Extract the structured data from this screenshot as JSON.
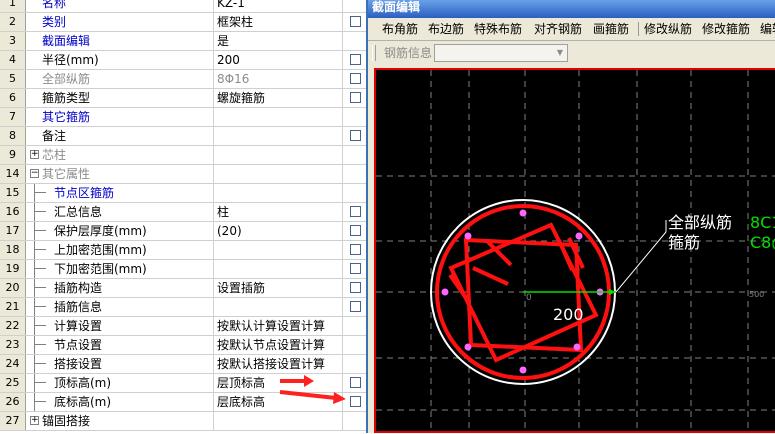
{
  "grid": {
    "rows": [
      {
        "num": "1",
        "name": "名称",
        "value": "KZ-1",
        "name_class": "blue",
        "checkbox": false
      },
      {
        "num": "2",
        "name": "类别",
        "value": "框架柱",
        "name_class": "blue",
        "checkbox": true
      },
      {
        "num": "3",
        "name": "截面编辑",
        "value": "是",
        "name_class": "blue",
        "checkbox": false
      },
      {
        "num": "4",
        "name": "半径(mm)",
        "value": "200",
        "name_class": "",
        "checkbox": true
      },
      {
        "num": "5",
        "name": "全部纵筋",
        "value": "8Φ16",
        "name_class": "gray",
        "value_class": "gray",
        "checkbox": true
      },
      {
        "num": "6",
        "name": "箍筋类型",
        "value": "螺旋箍筋",
        "name_class": "",
        "checkbox": true
      },
      {
        "num": "7",
        "name": "其它箍筋",
        "value": "",
        "name_class": "blue",
        "checkbox": false
      },
      {
        "num": "8",
        "name": "备注",
        "value": "",
        "name_class": "",
        "checkbox": true
      },
      {
        "num": "9",
        "name": "芯柱",
        "value": "",
        "name_class": "gray",
        "expander": "+",
        "checkbox": false
      },
      {
        "num": "14",
        "name": "其它属性",
        "value": "",
        "name_class": "gray",
        "expander": "−",
        "checkbox": false
      },
      {
        "num": "15",
        "name": "节点区箍筋",
        "value": "",
        "name_class": "blue",
        "child": true,
        "checkbox": false
      },
      {
        "num": "16",
        "name": "汇总信息",
        "value": "柱",
        "name_class": "",
        "child": true,
        "checkbox": true
      },
      {
        "num": "17",
        "name": "保护层厚度(mm)",
        "value": "(20)",
        "name_class": "",
        "child": true,
        "checkbox": true
      },
      {
        "num": "18",
        "name": "上加密范围(mm)",
        "value": "",
        "name_class": "",
        "child": true,
        "checkbox": true
      },
      {
        "num": "19",
        "name": "下加密范围(mm)",
        "value": "",
        "name_class": "",
        "child": true,
        "checkbox": true
      },
      {
        "num": "20",
        "name": "插筋构造",
        "value": "设置插筋",
        "name_class": "",
        "child": true,
        "checkbox": true
      },
      {
        "num": "21",
        "name": "插筋信息",
        "value": "",
        "name_class": "",
        "child": true,
        "checkbox": true
      },
      {
        "num": "22",
        "name": "计算设置",
        "value": "按默认计算设置计算",
        "name_class": "",
        "child": true,
        "checkbox": false
      },
      {
        "num": "23",
        "name": "节点设置",
        "value": "按默认节点设置计算",
        "name_class": "",
        "child": true,
        "checkbox": false
      },
      {
        "num": "24",
        "name": "搭接设置",
        "value": "按默认搭接设置计算",
        "name_class": "",
        "child": true,
        "checkbox": false
      },
      {
        "num": "25",
        "name": "顶标高(m)",
        "value": "层顶标高",
        "name_class": "",
        "child": true,
        "checkbox": true
      },
      {
        "num": "26",
        "name": "底标高(m)",
        "value": "层底标高",
        "name_class": "",
        "child": true,
        "checkbox": true
      },
      {
        "num": "27",
        "name": "锚固搭接",
        "value": "",
        "name_class": "",
        "expander": "+",
        "checkbox": false
      }
    ]
  },
  "editor": {
    "title": "截面编辑",
    "toolbar": [
      "布角筋",
      "布边筋",
      "特殊布筋",
      "对齐钢筋",
      "画箍筋",
      "修改纵筋",
      "修改箍筋",
      "编辑"
    ],
    "rebar_info_label": "钢筋信息",
    "rebar_info_value": "",
    "canvas": {
      "callout_all": "全部纵筋",
      "callout_all_value": "8C1",
      "callout_stirrup": "箍筋",
      "callout_stirrup_value": "C8@",
      "radius_label": "200",
      "origin_label": "0",
      "scale_label": "500"
    }
  },
  "colors": {
    "accent_red": "#e00000",
    "name_blue": "#0000c8",
    "label_green": "#00e000"
  }
}
